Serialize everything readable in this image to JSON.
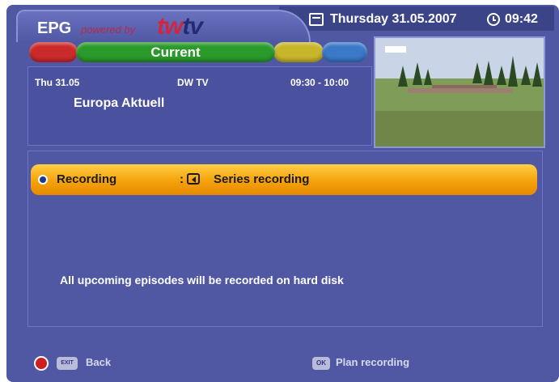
{
  "header": {
    "title": "EPG",
    "powered_by": "powered by",
    "logo_part1": "tw",
    "logo_part2": "tv",
    "date": "Thursday 31.05.2007",
    "time": "09:42",
    "icons": {
      "date": "calendar-icon",
      "time": "clock-icon"
    }
  },
  "color_buttons": {
    "red": "",
    "green": "Current",
    "yellow": "",
    "blue": "",
    "colors": {
      "red": "#cc2a2a",
      "green": "#2a9a2a",
      "yellow": "#c7b52a",
      "blue": "#3a78c8"
    }
  },
  "program": {
    "date": "Thu 31.05",
    "channel": "DW TV",
    "time_slot": "09:30 - 10:00",
    "title": "Europa Aktuell"
  },
  "recording": {
    "label": "Recording",
    "separator": ":",
    "value": "Series recording",
    "icons": {
      "bullet": "radio-dot-icon",
      "left": "arrow-left-icon"
    },
    "highlight_color": "#f5a20c"
  },
  "description": "All upcoming episodes will be recorded on hard disk",
  "footer": {
    "back_key": "EXIT",
    "back_label": "Back",
    "ok_key": "OK",
    "plan_label": "Plan recording"
  }
}
